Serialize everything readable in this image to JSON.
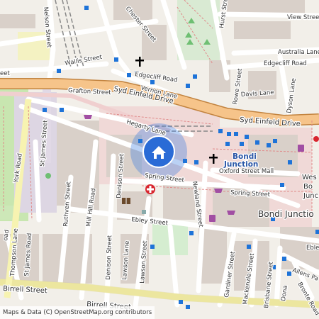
{
  "map": {
    "attribution": "Maps & Data (C) OpenStreetMap.org contributors",
    "location_marker": {
      "icon": "home-icon",
      "color": "#2a6bd6"
    },
    "poi_colors": {
      "bus_stop": "#1e73d8",
      "pharmacy": "#d8262f",
      "shop": "#a14ea3",
      "church": "#000000",
      "library": "#6b4a2c"
    },
    "street_labels": {
      "view": "View Street",
      "australia": "Australia Lane",
      "edgecliff_road": "Edgecliff Road",
      "edgecliff_road_2": "Edgecliff Road",
      "davis": "Davis Lane",
      "dyson": "Dyson Lane",
      "rowe": "Rowe Street",
      "hurst": "Hurst Street",
      "chester": "Chester Street",
      "nelson": "Nelson Street",
      "wallis": "Wallis Street",
      "vernon": "Vernon Lane",
      "grafton": "Grafton Street",
      "syd_einfeld_w": "Syd Einfeld Drive",
      "syd_einfeld_e": "Syd Einfeld Drive",
      "hegarty": "Hegarty Lane",
      "oxford_mall": "Oxford Street Mall",
      "spring_w": "Spring Street",
      "spring_e": "Spring Street",
      "newland": "Newland Street",
      "denison": "Denison Street",
      "denison_lower": "Denison Street",
      "ebley": "Ebley Street",
      "ebley_e": "Eble",
      "mill_hill": "Mill Hill Road",
      "ruthven": "Ruthven Street",
      "st_james_st": "St James Street",
      "st_james_rd": "St James Road",
      "thompson": "Thompson Lane",
      "york": "York Road",
      "oad": "oad",
      "lawson_lane": "Lawson Lane",
      "lawson_st": "Lawson Street",
      "birrell_w": "Birrell Street",
      "birrell_e": "Birrell Street",
      "gardiner": "Gardiner Street",
      "mackenzie": "Mackenzie Street",
      "brisbane": "Brisbane Street",
      "allens": "Allens Pa",
      "bronte": "Bronte Road",
      "dona": "Dona",
      "eet": "eet"
    },
    "place_labels": {
      "bondi_junction_station_1": "Bondi",
      "bondi_junction_station_2": "Junction",
      "bondi_junction": "Bondi Junctio",
      "westfield_1": "Wes",
      "westfield_2": "Bo",
      "westfield_3": "Junc"
    }
  }
}
